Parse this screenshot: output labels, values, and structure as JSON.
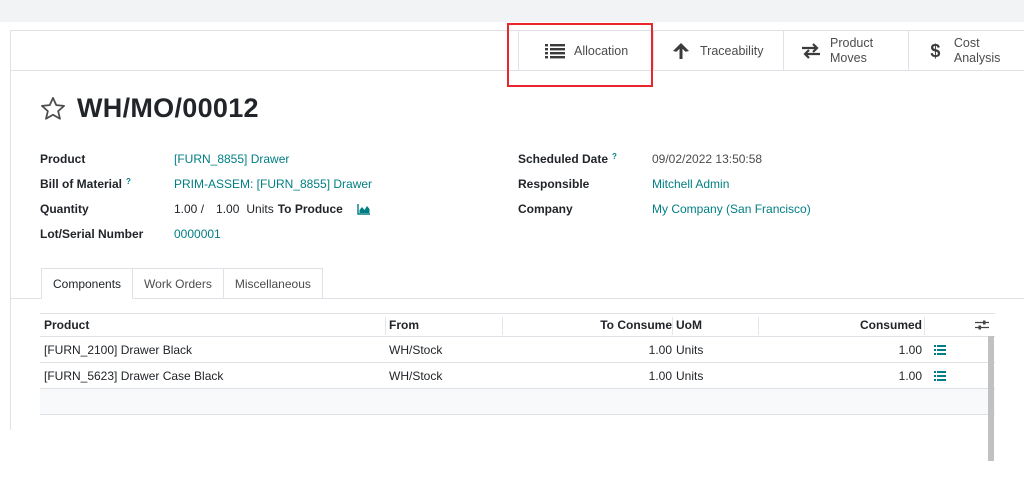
{
  "smart_buttons": {
    "allocation": "Allocation",
    "traceability": "Traceability",
    "product_moves_line1": "Product",
    "product_moves_line2": "Moves",
    "cost_analysis": "Cost Analysis"
  },
  "record": {
    "title": "WH/MO/00012"
  },
  "fields_left": {
    "product_label": "Product",
    "product_value": "[FURN_8855] Drawer",
    "bom_label": "Bill of Material",
    "bom_help": "?",
    "bom_value": "PRIM-ASSEM: [FURN_8855] Drawer",
    "quantity_label": "Quantity",
    "quantity_value": "1.00 /",
    "quantity_target": "1.00",
    "quantity_uom": "Units",
    "quantity_suffix": "To Produce",
    "lot_label": "Lot/Serial Number",
    "lot_value": "0000001"
  },
  "fields_right": {
    "scheduled_label": "Scheduled Date",
    "scheduled_help": "?",
    "scheduled_value": "09/02/2022 13:50:58",
    "responsible_label": "Responsible",
    "responsible_value": "Mitchell Admin",
    "company_label": "Company",
    "company_value": "My Company (San Francisco)"
  },
  "tabs": [
    {
      "label": "Components",
      "active": true
    },
    {
      "label": "Work Orders",
      "active": false
    },
    {
      "label": "Miscellaneous",
      "active": false
    }
  ],
  "table": {
    "headers": {
      "product": "Product",
      "from": "From",
      "to_consume": "To Consume",
      "uom": "UoM",
      "consumed": "Consumed"
    },
    "rows": [
      {
        "product": "[FURN_2100] Drawer Black",
        "from": "WH/Stock",
        "to_consume": "1.00",
        "uom": "Units",
        "consumed": "1.00"
      },
      {
        "product": "[FURN_5623] Drawer Case Black",
        "from": "WH/Stock",
        "to_consume": "1.00",
        "uom": "Units",
        "consumed": "1.00"
      }
    ]
  },
  "colors": {
    "link": "#017e84",
    "highlight_box": "#e8262b"
  },
  "icons": {
    "allocation": "list-icon",
    "traceability": "arrow-up-icon",
    "product_moves": "exchange-arrows-icon",
    "cost_analysis": "dollar-icon",
    "favorite": "star-outline-icon",
    "forecast": "area-chart-icon",
    "optional_columns": "sliders-icon",
    "row_detail": "list-icon"
  }
}
